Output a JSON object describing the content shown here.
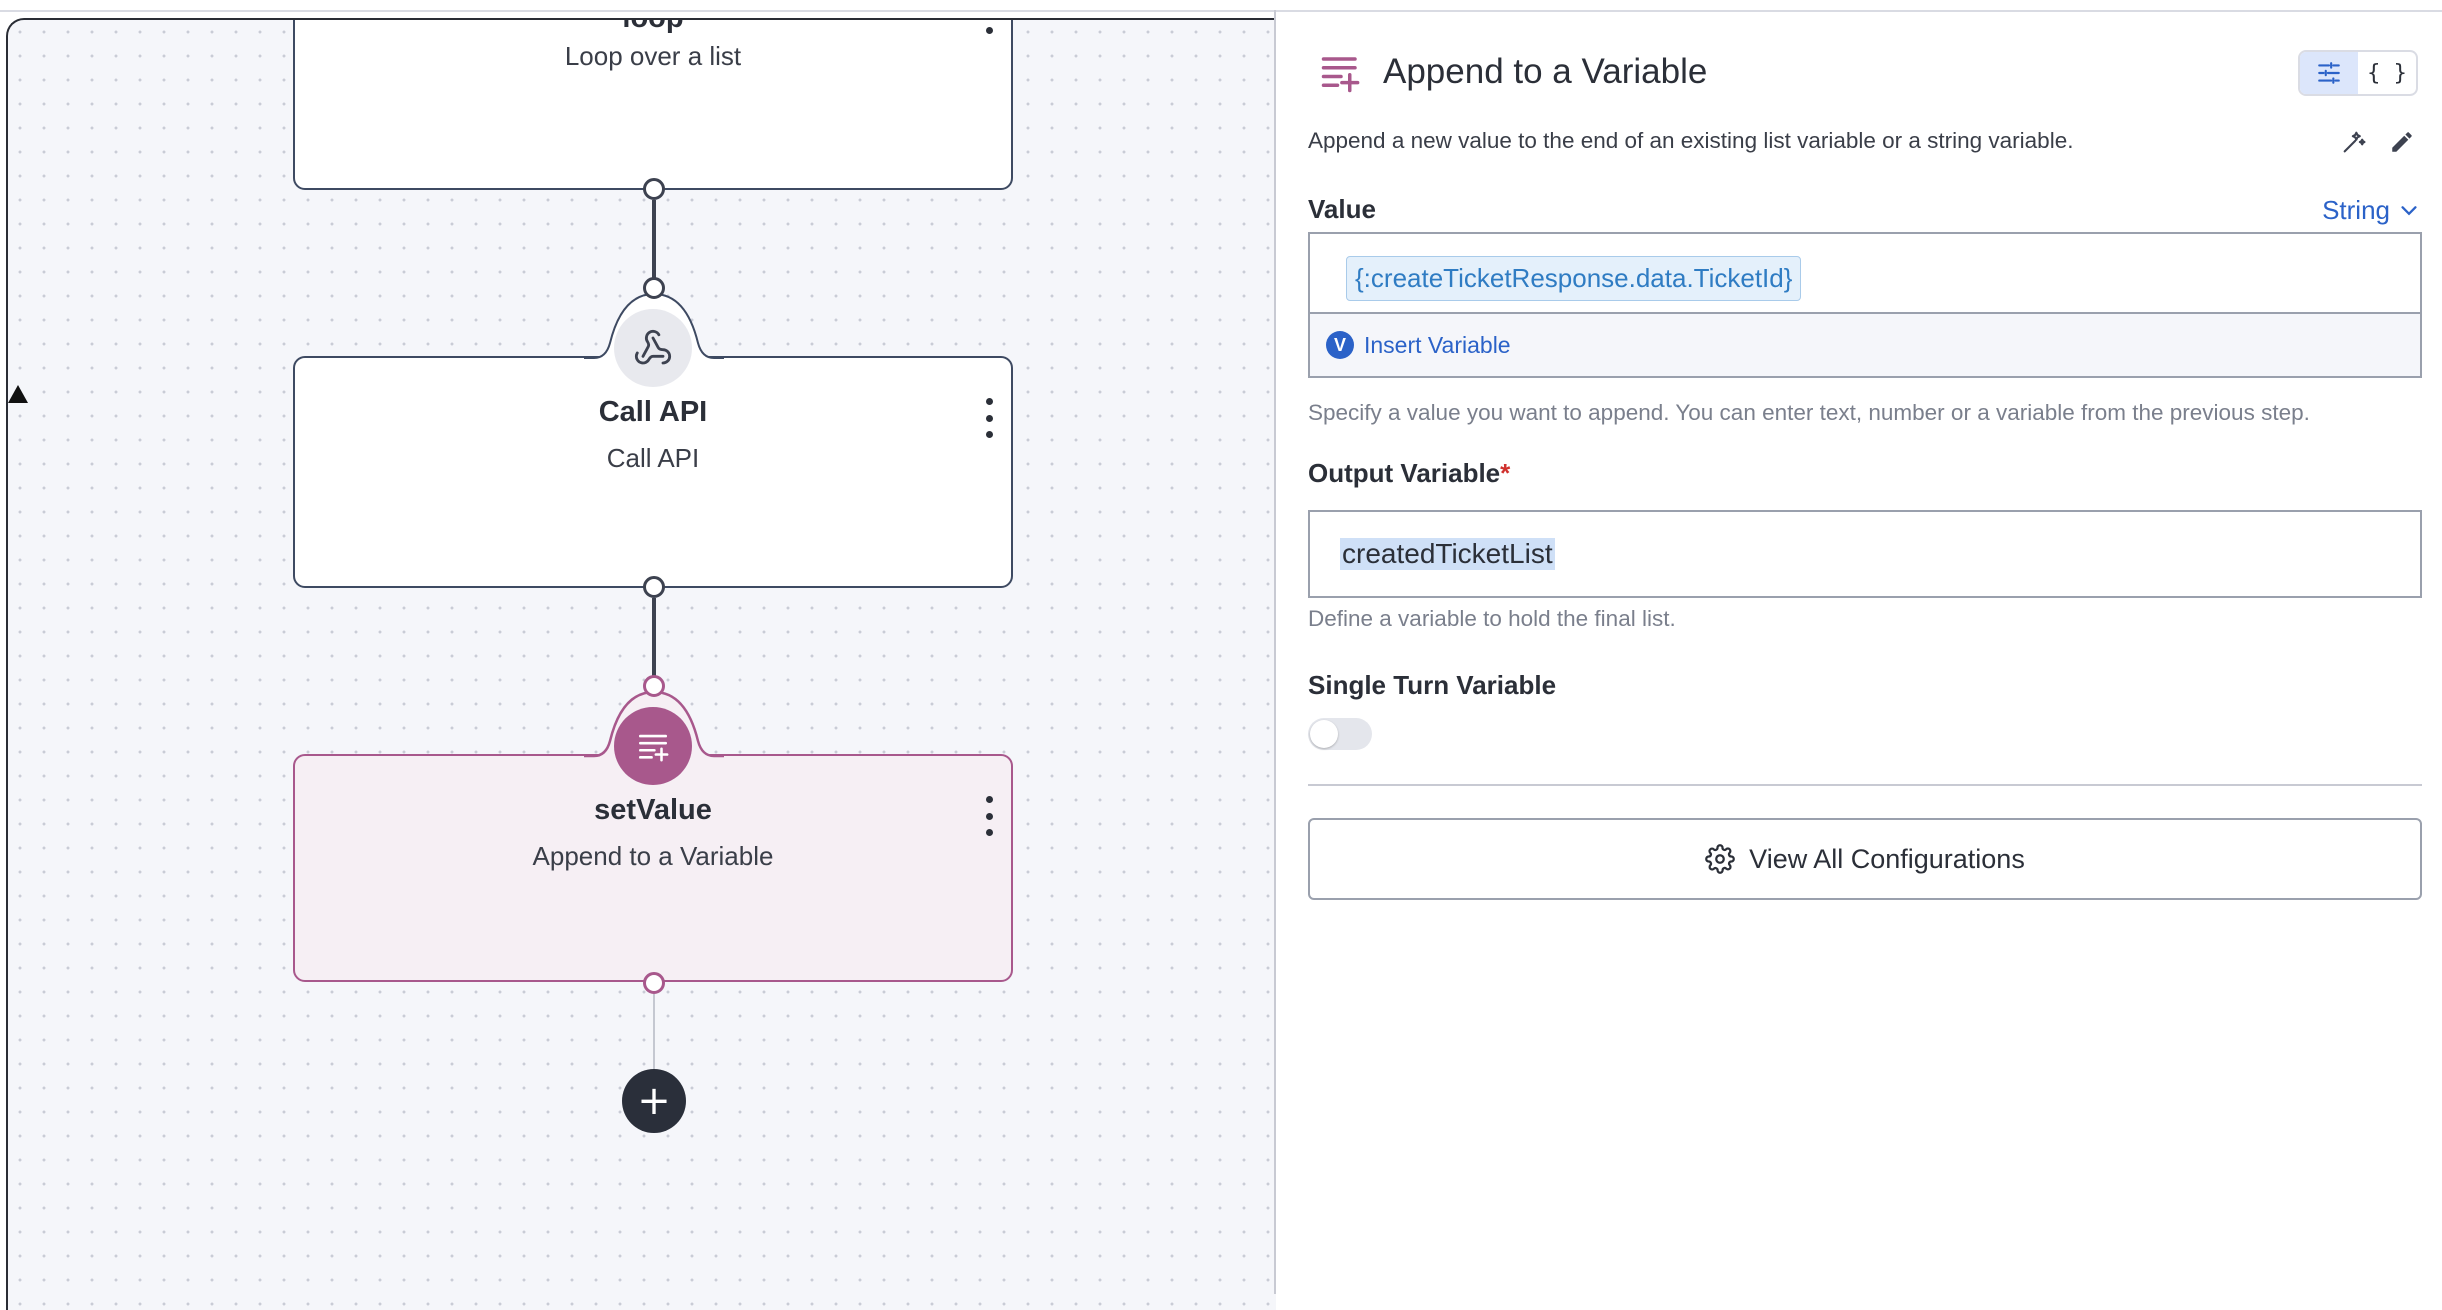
{
  "canvas": {
    "nodes": [
      {
        "id": "loop",
        "title": "loop",
        "subtitle": "Loop over a list"
      },
      {
        "id": "call-api",
        "title": "Call API",
        "subtitle": "Call API",
        "icon": "webhook-icon"
      },
      {
        "id": "set-value",
        "title": "setValue",
        "subtitle": "Append to a Variable",
        "icon": "append-list-icon",
        "accent": "#a8588c"
      }
    ],
    "add_button_label": "+"
  },
  "panel": {
    "title": "Append to a Variable",
    "json_toggle_label": "{ }",
    "description": "Append a new value to the end of an existing list variable or a string variable.",
    "value": {
      "label": "Value",
      "type": "String",
      "chip": "{:createTicketResponse.data.TicketId}",
      "insert_badge": "V",
      "insert_label": "Insert Variable",
      "help": "Specify a value you want to append. You can enter text, number or a variable from the previous step."
    },
    "output": {
      "label": "Output Variable",
      "required_mark": "*",
      "value": "createdTicketList",
      "help": "Define a variable to hold the final list."
    },
    "single_turn": {
      "label": "Single Turn Variable",
      "enabled": false
    },
    "view_all_label": "View All Configurations"
  },
  "colors": {
    "accent": "#2b62c8",
    "node_accent": "#a8588c",
    "node_bg": "#f6eff4"
  }
}
